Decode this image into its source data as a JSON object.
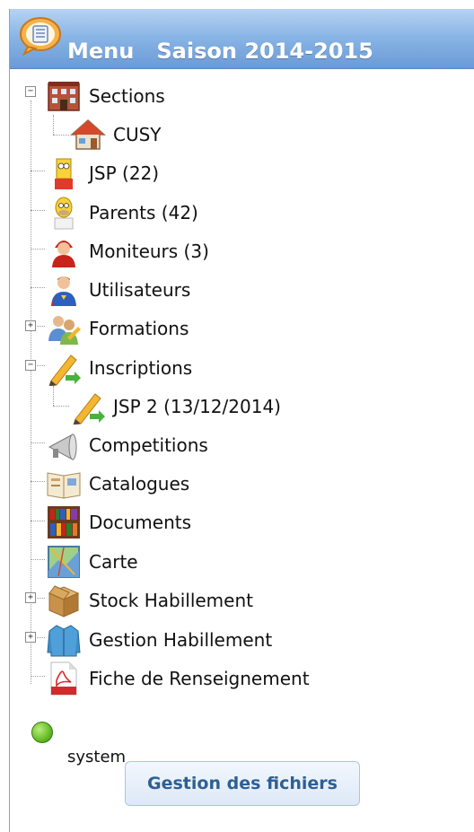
{
  "header": {
    "title": "Menu   Saison 2014-2015",
    "icon": "chat-menu-icon"
  },
  "tree": {
    "items": [
      {
        "label": "Sections",
        "icon": "building-icon",
        "expanded": true
      },
      {
        "label": "CUSY",
        "icon": "house-icon"
      },
      {
        "label": "JSP (22)",
        "icon": "bart-icon"
      },
      {
        "label": "Parents (42)",
        "icon": "homer-icon"
      },
      {
        "label": "Moniteurs (3)",
        "icon": "firefighter-icon"
      },
      {
        "label": "Utilisateurs",
        "icon": "superhero-icon"
      },
      {
        "label": "Formations",
        "icon": "users-edit-icon",
        "expanded": false
      },
      {
        "label": "Inscriptions",
        "icon": "pencil-arrow-icon",
        "expanded": true
      },
      {
        "label": "JSP 2 (13/12/2014)",
        "icon": "pencil-arrow-icon"
      },
      {
        "label": "Competitions",
        "icon": "megaphone-icon"
      },
      {
        "label": "Catalogues",
        "icon": "open-book-icon"
      },
      {
        "label": "Documents",
        "icon": "bookshelf-icon"
      },
      {
        "label": "Carte",
        "icon": "map-icon"
      },
      {
        "label": "Stock Habillement",
        "icon": "box-icon",
        "expanded": false
      },
      {
        "label": "Gestion Habillement",
        "icon": "jacket-icon",
        "expanded": false
      },
      {
        "label": "Fiche de Renseignement",
        "icon": "pdf-icon"
      }
    ]
  },
  "status": {
    "label": "system",
    "color": "#6cc02c"
  },
  "files_button": {
    "label": "Gestion des fichiers"
  },
  "colors": {
    "header": "#8ab6e6",
    "button_text": "#2f5f93"
  }
}
